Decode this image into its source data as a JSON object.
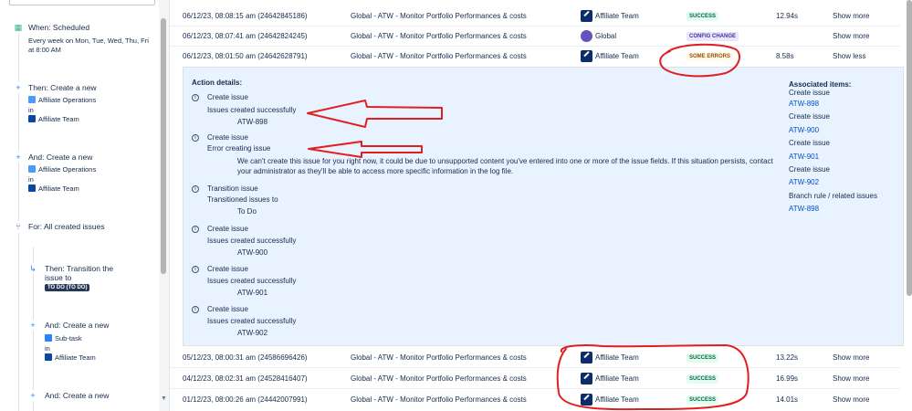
{
  "sidebar": {
    "trigger": {
      "title": "When: Scheduled",
      "schedule": "Every week on Mon, Tue, Wed, Thu, Fri",
      "time": "at 8:00 AM"
    },
    "action1": {
      "title": "Then: Create a new",
      "type": "Affiliate Operations",
      "in": "in",
      "project": "Affiliate Team"
    },
    "action2": {
      "title": "And: Create a new",
      "type": "Affiliate Operations",
      "in": "in",
      "project": "Affiliate Team"
    },
    "branch": {
      "title": "For: All created issues"
    },
    "transition": {
      "title_line1": "Then: Transition the",
      "title_line2": "issue to",
      "status": "TO DO (TO DO)"
    },
    "action3": {
      "title": "And: Create a new",
      "type": "Sub-task",
      "in": "in",
      "project": "Affiliate Team"
    },
    "action4": {
      "title": "And: Create a new"
    }
  },
  "rows_top": [
    {
      "date": "06/12/23, 08:08:15 am (24642845186)",
      "rule": "Global - ATW - Monitor Portfolio Performances & costs",
      "actor": "Affiliate Team",
      "status": "SUCCESS",
      "duration": "12.94s",
      "action": "Show more"
    },
    {
      "date": "06/12/23, 08:07:41 am (24642824245)",
      "rule": "Global - ATW - Monitor Portfolio Performances & costs",
      "actor": "Global",
      "status": "CONFIG CHANGE",
      "duration": "",
      "action": "Show more"
    },
    {
      "date": "06/12/23, 08:01:50 am (24642628791)",
      "rule": "Global - ATW - Monitor Portfolio Performances & costs",
      "actor": "Affiliate Team",
      "status": "SOME ERRORS",
      "duration": "8.58s",
      "action": "Show less"
    }
  ],
  "details": {
    "title": "Action details:",
    "entries": [
      {
        "action": "Create issue",
        "result": "Issues created successfully",
        "key": "ATW-898"
      },
      {
        "action": "Create issue",
        "result": "Error creating issue",
        "message": "We can't create this issue for you right now, it could be due to unsupported content you've entered into one or more of the issue fields. If this situation persists, contact your administrator as they'll be able to access more specific information in the log file."
      },
      {
        "action": "Transition issue",
        "result": "Transitioned issues to",
        "key": "To Do"
      },
      {
        "action": "Create issue",
        "result": "Issues created successfully",
        "key": "ATW-900"
      },
      {
        "action": "Create issue",
        "result": "Issues created successfully",
        "key": "ATW-901"
      },
      {
        "action": "Create issue",
        "result": "Issues created successfully",
        "key": "ATW-902"
      }
    ],
    "associated": {
      "title": "Associated items:",
      "items": [
        {
          "label": "Create issue",
          "link": "ATW-898"
        },
        {
          "label": "Create issue",
          "link": "ATW-900"
        },
        {
          "label": "Create issue",
          "link": "ATW-901"
        },
        {
          "label": "Create issue",
          "link": "ATW-902"
        },
        {
          "label": "Branch rule / related issues",
          "link": "ATW-898"
        }
      ]
    }
  },
  "rows_bottom": [
    {
      "date": "05/12/23, 08:00:31 am (24586696426)",
      "rule": "Global - ATW - Monitor Portfolio Performances & costs",
      "actor": "Affiliate Team",
      "status": "SUCCESS",
      "duration": "13.22s",
      "action": "Show more"
    },
    {
      "date": "04/12/23, 08:02:31 am (24528416407)",
      "rule": "Global - ATW - Monitor Portfolio Performances & costs",
      "actor": "Affiliate Team",
      "status": "SUCCESS",
      "duration": "16.99s",
      "action": "Show more"
    },
    {
      "date": "01/12/23, 08:00:26 am (24442007991)",
      "rule": "Global - ATW - Monitor Portfolio Performances & costs",
      "actor": "Affiliate Team",
      "status": "SUCCESS",
      "duration": "14.01s",
      "action": "Show more"
    }
  ],
  "colors": {
    "link": "#0052cc",
    "success": "#006644",
    "annotation": "#e02020",
    "detail_bg": "#e9f2ff"
  }
}
